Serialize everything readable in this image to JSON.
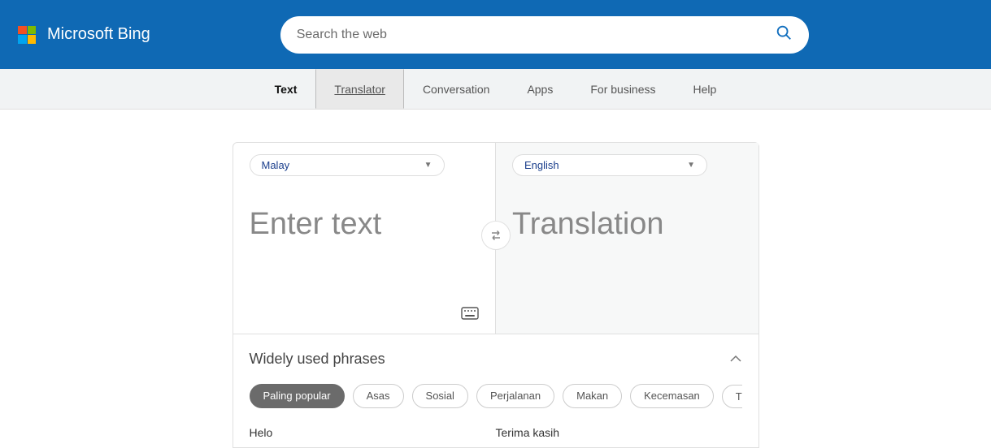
{
  "header": {
    "brand": "Microsoft Bing",
    "search_placeholder": "Search the web"
  },
  "tabs": {
    "text": "Text",
    "translator": "Translator",
    "conversation": "Conversation",
    "apps": "Apps",
    "business": "For business",
    "help": "Help"
  },
  "translator": {
    "source_lang": "Malay",
    "target_lang": "English",
    "source_placeholder": "Enter text",
    "target_placeholder": "Translation"
  },
  "phrases": {
    "title": "Widely used phrases",
    "chips": {
      "popular": "Paling popular",
      "asas": "Asas",
      "sosial": "Sosial",
      "perjalanan": "Perjalanan",
      "makan": "Makan",
      "kecemasan": "Kecemasan",
      "t": "T"
    },
    "items": {
      "helo": "Helo",
      "terima": "Terima kasih"
    }
  }
}
